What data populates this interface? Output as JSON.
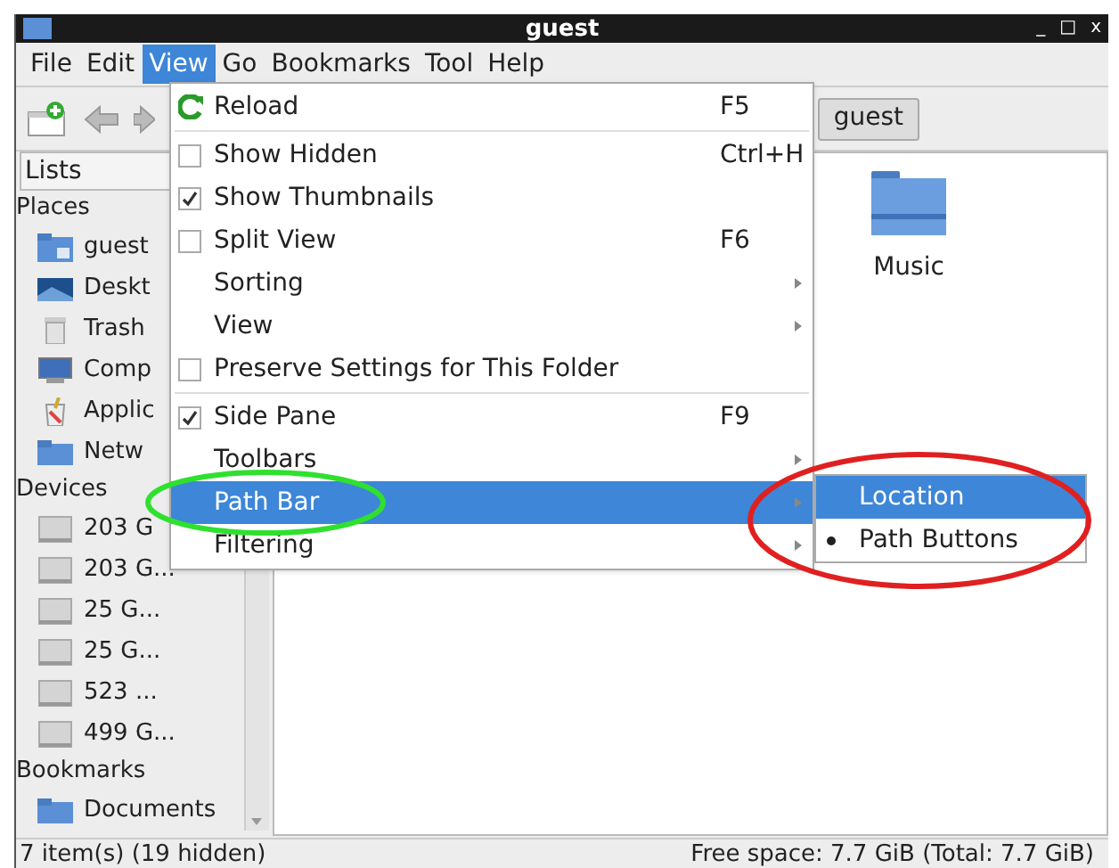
{
  "window": {
    "title": "guest",
    "controls": [
      "_",
      "□",
      "x"
    ]
  },
  "menubar": [
    {
      "label": "File",
      "selected": false
    },
    {
      "label": "Edit",
      "selected": false
    },
    {
      "label": "View",
      "selected": true
    },
    {
      "label": "Go",
      "selected": false
    },
    {
      "label": "Bookmarks",
      "selected": false
    },
    {
      "label": "Tool",
      "selected": false
    },
    {
      "label": "Help",
      "selected": false
    }
  ],
  "toolbar": {
    "path_button": "guest"
  },
  "sidebar": {
    "header": "Lists",
    "sections": [
      {
        "title": "Places",
        "items": [
          {
            "label": "guest",
            "kind": "home"
          },
          {
            "label": "Deskt",
            "kind": "desktop"
          },
          {
            "label": "Trash",
            "kind": "trash"
          },
          {
            "label": "Comp",
            "kind": "computer"
          },
          {
            "label": "Applic",
            "kind": "apps"
          },
          {
            "label": "Netw",
            "kind": "folder"
          }
        ]
      },
      {
        "title": "Devices",
        "items": [
          {
            "label": "203 G",
            "kind": "drive"
          },
          {
            "label": "203 G...",
            "kind": "drive"
          },
          {
            "label": "25 G...",
            "kind": "drive"
          },
          {
            "label": "25 G...",
            "kind": "drive"
          },
          {
            "label": "523 ...",
            "kind": "drive"
          },
          {
            "label": "499 G...",
            "kind": "drive"
          }
        ]
      },
      {
        "title": "Bookmarks",
        "items": [
          {
            "label": "Documents",
            "kind": "folder"
          }
        ]
      }
    ]
  },
  "files": [
    {
      "name": "Music"
    }
  ],
  "view_menu": [
    {
      "kind": "action",
      "label": "Reload",
      "shortcut": "F5"
    },
    {
      "kind": "separator"
    },
    {
      "kind": "check",
      "label": "Show Hidden",
      "shortcut": "Ctrl+H",
      "checked": false
    },
    {
      "kind": "check",
      "label": "Show Thumbnails",
      "checked": true
    },
    {
      "kind": "check",
      "label": "Split View",
      "shortcut": "F6",
      "checked": false
    },
    {
      "kind": "submenu",
      "label": "Sorting",
      "highlighted": false
    },
    {
      "kind": "submenu",
      "label": "View",
      "highlighted": false
    },
    {
      "kind": "check",
      "label": "Preserve Settings for This Folder",
      "checked": false
    },
    {
      "kind": "separator"
    },
    {
      "kind": "check",
      "label": "Side Pane",
      "shortcut": "F9",
      "checked": true
    },
    {
      "kind": "submenu",
      "label": "Toolbars",
      "highlighted": false
    },
    {
      "kind": "submenu",
      "label": "Path Bar",
      "highlighted": true
    },
    {
      "kind": "submenu",
      "label": "Filtering",
      "highlighted": false
    }
  ],
  "path_bar_submenu": [
    {
      "label": "Location",
      "selected": false,
      "highlighted": true
    },
    {
      "label": "Path Buttons",
      "selected": true,
      "highlighted": false
    }
  ],
  "status_bar": {
    "items": "7 item(s) (19 hidden)",
    "free_space": "Free space: 7.7 GiB (Total: 7.7 GiB)"
  }
}
